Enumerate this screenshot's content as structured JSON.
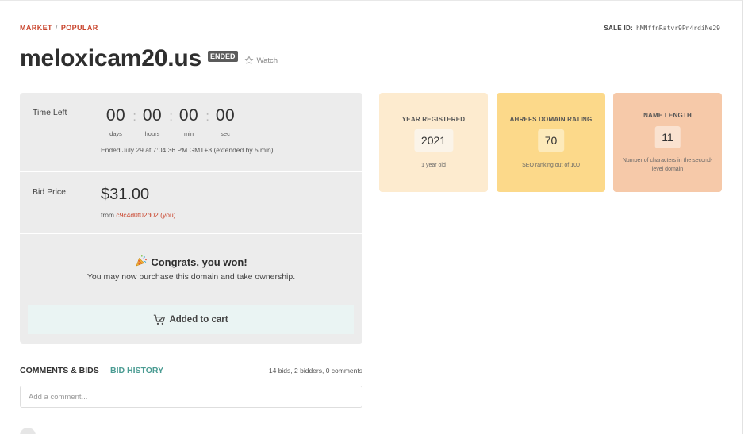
{
  "breadcrumb": {
    "market": "MARKET",
    "separator": "/",
    "popular": "POPULAR"
  },
  "sale": {
    "label": "SALE ID:",
    "id": "hMNffnRatvr9Pn4rdiNe29"
  },
  "domain": {
    "name": "meloxicam20.us",
    "status": "ENDED",
    "watch_label": "Watch"
  },
  "time_left": {
    "label": "Time Left",
    "units": [
      {
        "value": "00",
        "unit": "days"
      },
      {
        "value": "00",
        "unit": "hours"
      },
      {
        "value": "00",
        "unit": "min"
      },
      {
        "value": "00",
        "unit": "sec"
      }
    ],
    "ended_note": "Ended July 29 at 7:04:36 PM GMT+3 (extended by 5 min)"
  },
  "bid": {
    "label": "Bid Price",
    "price": "$31.00",
    "from_prefix": "from",
    "bidder": "c9c4d0f02d02 (you)"
  },
  "won": {
    "title": "Congrats, you won!",
    "subtitle": "You may now purchase this domain and take ownership.",
    "cart_label": "Added to cart"
  },
  "tabs": {
    "comments": "COMMENTS & BIDS",
    "history": "BID HISTORY",
    "stats": "14 bids, 2 bidders, 0 comments"
  },
  "comment": {
    "placeholder": "Add a comment..."
  },
  "cards": [
    {
      "title": "YEAR REGISTERED",
      "value": "2021",
      "sub": "1 year old",
      "color": "#fdebcf"
    },
    {
      "title": "AHREFS DOMAIN RATING",
      "value": "70",
      "sub": "SEO ranking out of 100",
      "color": "#fcd98a"
    },
    {
      "title": "NAME LENGTH",
      "value": "11",
      "sub": "Number of characters in the second-level domain",
      "color": "#f6c9a9"
    }
  ],
  "colors": {
    "accent": "#c9442c",
    "teal": "#4b9c93"
  }
}
